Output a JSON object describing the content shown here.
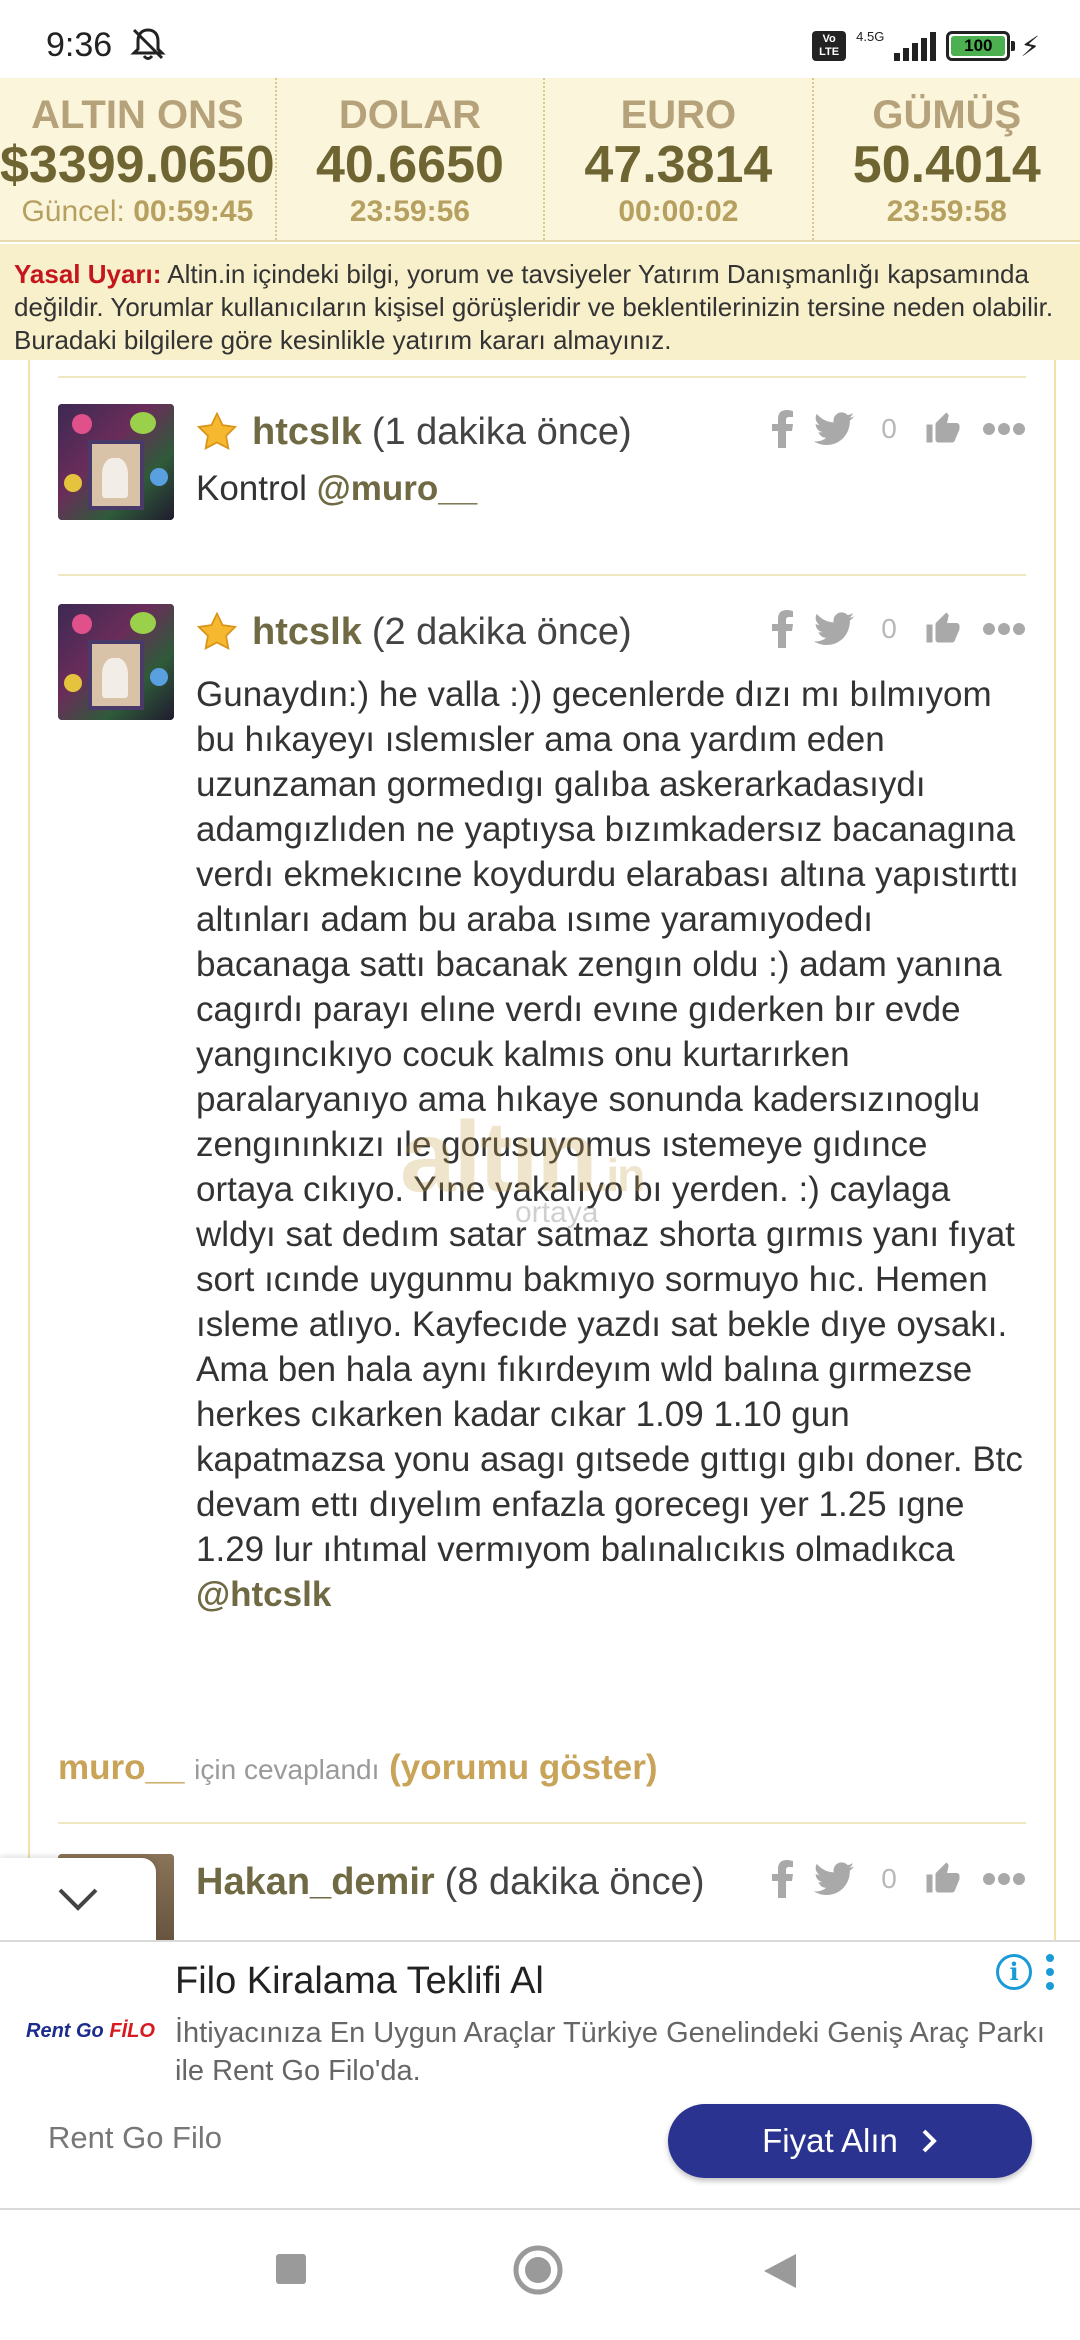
{
  "status_bar": {
    "time": "9:36",
    "volte": "Vo LTE",
    "network": "4.5G",
    "battery": "100"
  },
  "ticker": [
    {
      "name": "ALTIN ONS",
      "price": "$3399.0650",
      "time_label": "Güncel:",
      "time": "00:59:45"
    },
    {
      "name": "DOLAR",
      "price": "40.6650",
      "time_label": "",
      "time": "23:59:56"
    },
    {
      "name": "EURO",
      "price": "47.3814",
      "time_label": "",
      "time": "00:00:02"
    },
    {
      "name": "GÜMÜŞ",
      "price": "50.4014",
      "time_label": "",
      "time": "23:59:58"
    }
  ],
  "warning": {
    "title": "Yasal Uyarı:",
    "text": "Altin.in içindeki bilgi, yorum ve tavsiyeler Yatırım Danışmanlığı kapsamında değildir. Yorumlar kullanıcıların kişisel görüşleridir ve beklentilerinizin tersine neden olabilir. Buradaki bilgilere göre kesinlikle yatırım kararı almayınız."
  },
  "comments": [
    {
      "user": "htcslk",
      "ago": "(1 dakika önce)",
      "likes": "0",
      "body_text": "Kontrol ",
      "mention": "@muro__"
    },
    {
      "user": "htcslk",
      "ago": "(2 dakika önce)",
      "likes": "0",
      "body_text": "Gunaydın:) he valla :)) gecenlerde dızı mı bılmıyom bu hıkayeyı ıslemısler ama ona yardım eden uzunzaman gormedıgı galıba askerarkadasıydı adamgızlıden ne yaptıysa bızımkadersız bacanagına verdı ekmekıcıne koydurdu elarabası altına yapıstırttı altınları adam bu araba ısıme yaramıyodedı bacanaga sattı bacanak zengın oldu :) adam yanına cagırdı parayı elıne verdı evıne gıderken bır evde yangıncıkıyo cocuk kalmıs onu kurtarırken paralaryanıyo ama hıkaye sonunda kadersızınoglu zengınınkızı ıle gorusuyomus ıstemeye gıdınce ortaya cıkıyo. Yıne yakalıyo bı yerden. :) caylaga wldyı sat dedım satar satmaz shorta gırmıs yanı fıyat sort ıcınde uygunmu bakmıyo sormuyo hıc. Hemen ısleme atlıyo. Kayfecıde yazdı sat bekle dıye oysakı. Ama ben hala aynı fıkırdeyım wld balına gırmezse herkes cıkarken kadar cıkar 1.09 1.10 gun kapatmazsa yonu asagı gıtsede gıttıgı gıbı doner. Btc devam ettı dıyelım enfazla gorecegı yer 1.25 ıgne 1.29 lur ıhtımal vermıyom balınalıcıkıs olmadıkca",
      "mention": "@htcslk",
      "reply_to": "muro__",
      "reply_text": "için cevaplandı",
      "show_label": "(yorumu göster)"
    },
    {
      "user": "Hakan_demir",
      "ago": "(8 dakika önce)",
      "likes": "0"
    }
  ],
  "watermark": {
    "text": "altın",
    "suffix": ".in",
    "sub": "ortaya"
  },
  "ad": {
    "logo_main": "Rent Go ",
    "logo_accent": "FİLO",
    "title": "Filo Kiralama Teklifi Al",
    "description": "İhtiyacınıza En Uygun Araçlar Türkiye Genelindeki Geniş Araç Parkı ile Rent Go Filo'da.",
    "brand": "Rent Go Filo",
    "cta": "Fiyat Alın",
    "info": "i"
  },
  "colors": {
    "ticker_bg": "#fbf5dc",
    "warning_red": "#c4161c",
    "username": "#6f6a43",
    "reply_gold": "#c8a358",
    "cta_blue": "#2b3390"
  },
  "icons": [
    "mute-icon",
    "signal-icon",
    "battery-icon",
    "star-icon",
    "facebook-icon",
    "twitter-icon",
    "like-icon",
    "more-icon",
    "chevron-down-icon",
    "info-icon",
    "chevron-right-icon",
    "recent-apps-icon",
    "home-icon",
    "back-icon"
  ]
}
